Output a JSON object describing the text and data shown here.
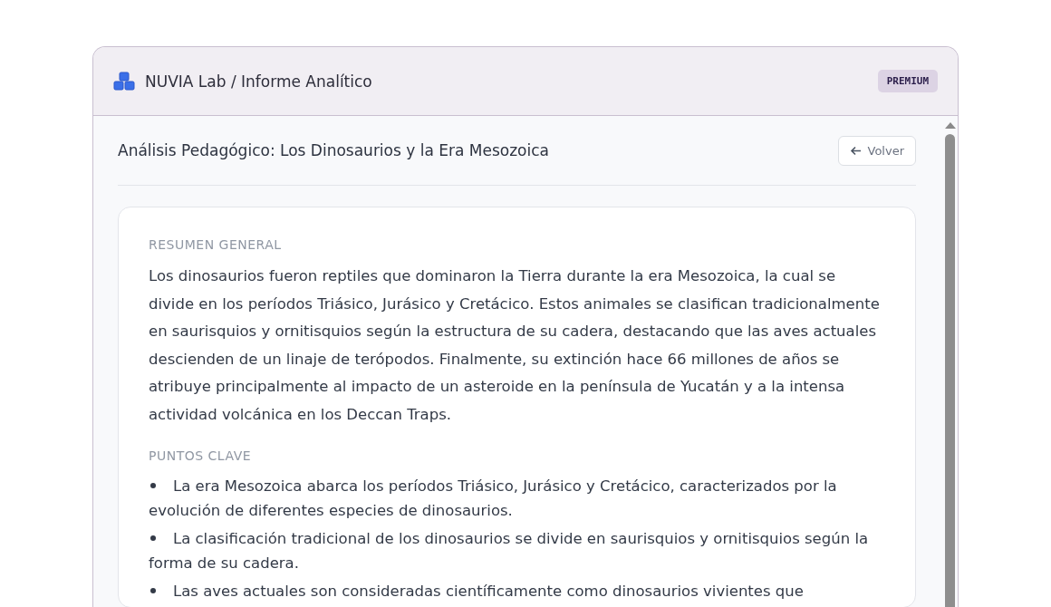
{
  "header": {
    "title": "NUVIA Lab / Informe Analítico",
    "badge": "PREMIUM"
  },
  "page": {
    "title": "Análisis Pedagógico: Los Dinosaurios y la Era Mesozoica",
    "back_button": "Volver"
  },
  "sections": [
    {
      "kind": "paragraph",
      "heading": "RESUMEN GENERAL",
      "text": "Los dinosaurios fueron reptiles que dominaron la Tierra durante la era Mesozoica, la cual se divide en los períodos Triásico, Jurásico y Cretácico. Estos animales se clasifican tradicionalmente en saurisquios y ornitisquios según la estructura de su cadera, destacando que las aves actuales descienden de un linaje de terópodos. Finalmente, su extinción hace 66 millones de años se atribuye principalmente al impacto de un asteroide en la península de Yucatán y a la intensa actividad volcánica en los Deccan Traps."
    },
    {
      "kind": "bullets",
      "heading": "PUNTOS CLAVE",
      "items": [
        "La era Mesozoica abarca los períodos Triásico, Jurásico y Cretácico, caracterizados por la evolución de diferentes especies de dinosaurios.",
        "La clasificación tradicional de los dinosaurios se divide en saurisquios y ornitisquios según la forma de su cadera.",
        "Las aves actuales son consideradas científicamente como dinosaurios vivientes que"
      ]
    }
  ]
}
